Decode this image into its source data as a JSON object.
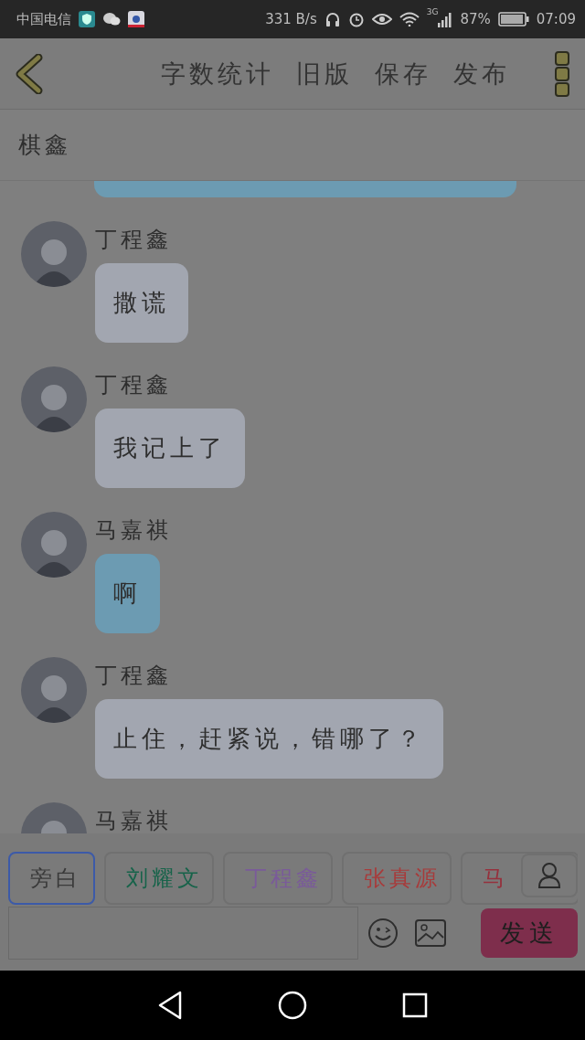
{
  "status_bar": {
    "carrier": "中国电信",
    "speed": "331 B/s",
    "network": "3G",
    "battery": "87%",
    "time": "07:09"
  },
  "header": {
    "actions": [
      "字数统计",
      "旧版",
      "保存",
      "发布"
    ]
  },
  "title": "棋鑫",
  "messages": [
    {
      "kind": "partial",
      "color": "#6c9bb2"
    },
    {
      "kind": "message",
      "name": "丁程鑫",
      "text": "撒谎",
      "color": "#a2a6b0"
    },
    {
      "kind": "message",
      "name": "丁程鑫",
      "text": "我记上了",
      "color": "#a2a6b0"
    },
    {
      "kind": "message",
      "name": "马嘉祺",
      "text": "啊",
      "color": "#6c9bb2"
    },
    {
      "kind": "message",
      "name": "丁程鑫",
      "text": "止住，赶紧说，错哪了？",
      "color": "#a2a6b0"
    },
    {
      "kind": "message",
      "name": "马嘉祺"
    }
  ],
  "characters": [
    {
      "label": "旁白",
      "selected": true,
      "color": "#3a3a3a"
    },
    {
      "label": "刘耀文",
      "selected": false,
      "color": "#17634a"
    },
    {
      "label": "丁程鑫",
      "selected": false,
      "color": "#7a5a9a"
    },
    {
      "label": "张真源",
      "selected": false,
      "color": "#a83a3a"
    },
    {
      "label": "马",
      "selected": false,
      "color": "#96303c"
    }
  ],
  "send_button": "发送"
}
